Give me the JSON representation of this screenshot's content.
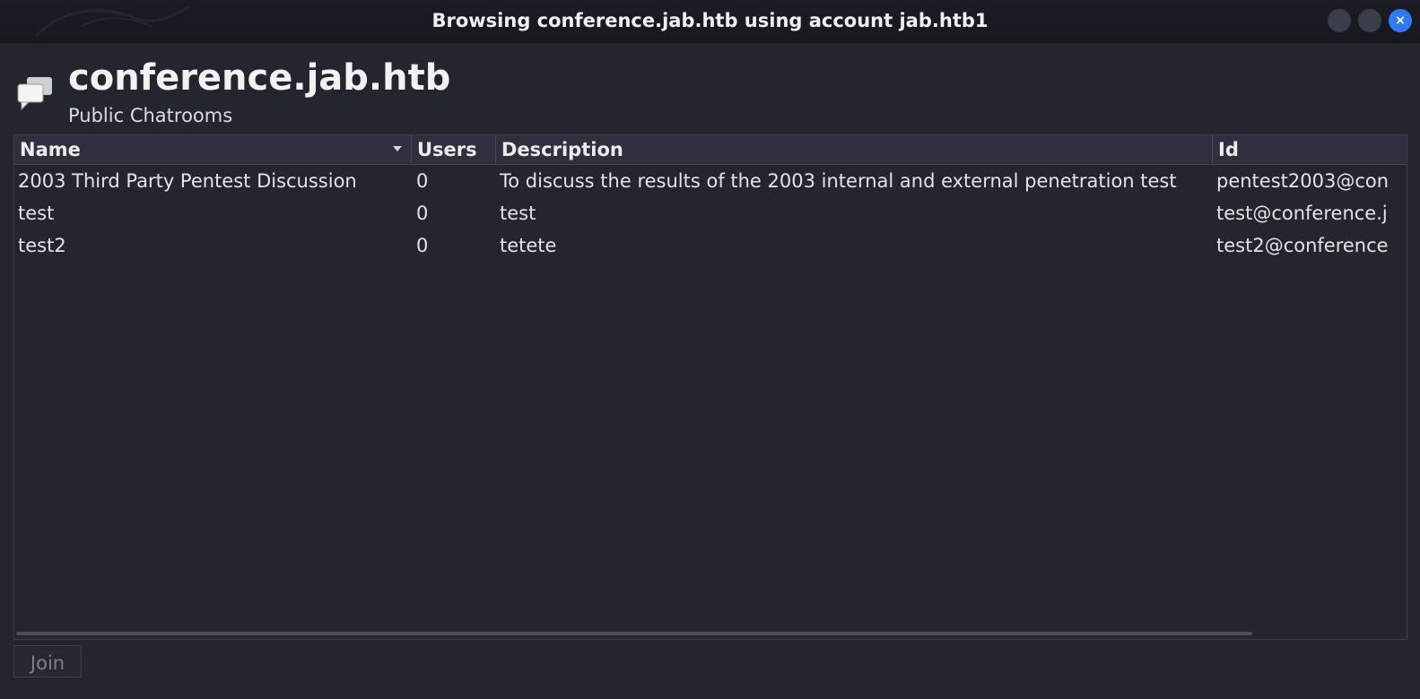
{
  "window": {
    "title": "Browsing conference.jab.htb using account jab.htb1",
    "close_glyph": "×"
  },
  "header": {
    "host": "conference.jab.htb",
    "subtitle": "Public Chatrooms",
    "icon": "chat-bubbles-icon"
  },
  "table": {
    "columns": [
      "Name",
      "Users",
      "Description",
      "Id"
    ],
    "sort_column": "Name",
    "rows": [
      {
        "name": "2003 Third Party Pentest Discussion",
        "users": "0",
        "description": "To discuss the results of the 2003 internal and external penetration test",
        "id": "pentest2003@con"
      },
      {
        "name": "test",
        "users": "0",
        "description": "test",
        "id": "test@conference.j"
      },
      {
        "name": "test2",
        "users": "0",
        "description": "tetete",
        "id": "test2@conference"
      }
    ]
  },
  "actions": {
    "join_label": "Join"
  },
  "colors": {
    "background": "#23252f",
    "titlebar": "#17181e",
    "accent": "#2f7bf5"
  }
}
